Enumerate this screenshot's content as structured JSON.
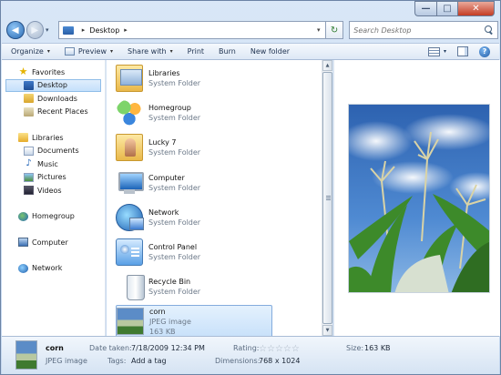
{
  "window": {
    "min_glyph": "—",
    "max_glyph": "□",
    "close_glyph": "✕"
  },
  "nav": {
    "back_glyph": "◀",
    "forward_glyph": "▶",
    "history_glyph": "▾"
  },
  "address": {
    "crumb": "Desktop",
    "sep": "▸",
    "drop": "▾",
    "refresh_glyph": "↻"
  },
  "search": {
    "placeholder": "Search Desktop"
  },
  "toolbar": {
    "organize": "Organize",
    "preview": "Preview",
    "share_with": "Share with",
    "print": "Print",
    "burn": "Burn",
    "new_folder": "New folder",
    "dropdown_glyph": "▾",
    "help_glyph": "?"
  },
  "sidebar": {
    "favorites": "Favorites",
    "desktop": "Desktop",
    "downloads": "Downloads",
    "recent_places": "Recent Places",
    "libraries": "Libraries",
    "documents": "Documents",
    "music": "Music",
    "pictures": "Pictures",
    "videos": "Videos",
    "homegroup": "Homegroup",
    "computer": "Computer",
    "network": "Network",
    "star_glyph": "★",
    "music_glyph": "♪"
  },
  "files": [
    {
      "name": "Libraries",
      "type": "System Folder",
      "icon": "libraries-icon"
    },
    {
      "name": "Homegroup",
      "type": "System Folder",
      "icon": "homegroup-icon"
    },
    {
      "name": "Lucky 7",
      "type": "System Folder",
      "icon": "user-folder-icon"
    },
    {
      "name": "Computer",
      "type": "System Folder",
      "icon": "computer-icon"
    },
    {
      "name": "Network",
      "type": "System Folder",
      "icon": "network-icon"
    },
    {
      "name": "Control Panel",
      "type": "System Folder",
      "icon": "control-panel-icon"
    },
    {
      "name": "Recycle Bin",
      "type": "System Folder",
      "icon": "recycle-bin-icon"
    },
    {
      "name": "corn",
      "type": "JPEG image",
      "size": "163 KB",
      "icon": "jpeg-thumbnail-icon"
    }
  ],
  "scrollbar": {
    "up_glyph": "▲",
    "down_glyph": "▼"
  },
  "details": {
    "name": "corn",
    "type": "JPEG image",
    "date_taken_label": "Date taken:",
    "date_taken_value": "7/18/2009 12:34 PM",
    "tags_label": "Tags:",
    "tags_value": "Add a tag",
    "rating_label": "Rating:",
    "rating_stars": 0,
    "star_glyph": "☆",
    "dimensions_label": "Dimensions:",
    "dimensions_value": "768 x 1024",
    "size_label": "Size:",
    "size_value": "163 KB"
  },
  "colors": {
    "accent": "#2b6cb4",
    "selection": "#c5e0fb",
    "chrome": "#d9e7f7"
  }
}
